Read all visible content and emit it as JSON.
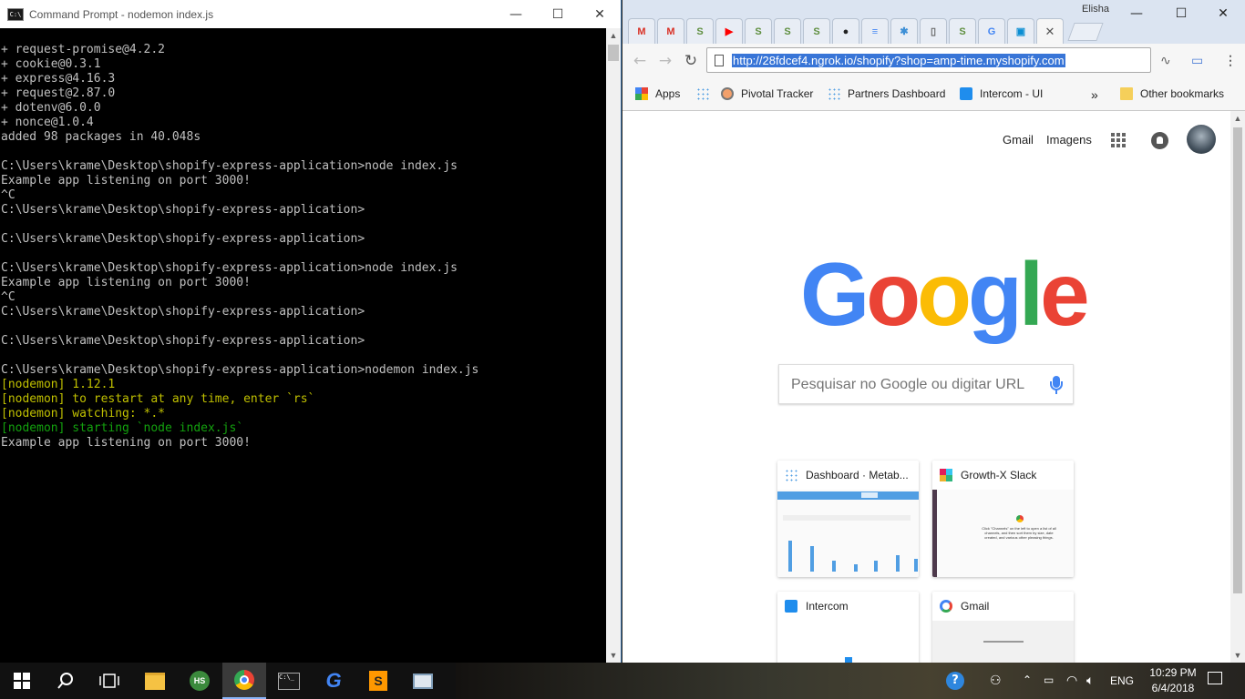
{
  "cmd": {
    "title": "Command Prompt - nodemon  index.js",
    "lines": [
      {
        "text": "+ request-promise@4.2.2",
        "color": ""
      },
      {
        "text": "+ cookie@0.3.1",
        "color": ""
      },
      {
        "text": "+ express@4.16.3",
        "color": ""
      },
      {
        "text": "+ request@2.87.0",
        "color": ""
      },
      {
        "text": "+ dotenv@6.0.0",
        "color": ""
      },
      {
        "text": "+ nonce@1.0.4",
        "color": ""
      },
      {
        "text": "added 98 packages in 40.048s",
        "color": ""
      },
      {
        "text": "",
        "color": ""
      },
      {
        "text": "C:\\Users\\krame\\Desktop\\shopify-express-application>node index.js",
        "color": ""
      },
      {
        "text": "Example app listening on port 3000!",
        "color": ""
      },
      {
        "text": "^C",
        "color": ""
      },
      {
        "text": "C:\\Users\\krame\\Desktop\\shopify-express-application>",
        "color": ""
      },
      {
        "text": "",
        "color": ""
      },
      {
        "text": "C:\\Users\\krame\\Desktop\\shopify-express-application>",
        "color": ""
      },
      {
        "text": "",
        "color": ""
      },
      {
        "text": "C:\\Users\\krame\\Desktop\\shopify-express-application>node index.js",
        "color": ""
      },
      {
        "text": "Example app listening on port 3000!",
        "color": ""
      },
      {
        "text": "^C",
        "color": ""
      },
      {
        "text": "C:\\Users\\krame\\Desktop\\shopify-express-application>",
        "color": ""
      },
      {
        "text": "",
        "color": ""
      },
      {
        "text": "C:\\Users\\krame\\Desktop\\shopify-express-application>",
        "color": ""
      },
      {
        "text": "",
        "color": ""
      },
      {
        "text": "C:\\Users\\krame\\Desktop\\shopify-express-application>nodemon index.js",
        "color": ""
      },
      {
        "text": "[nodemon] 1.12.1",
        "color": "yellow"
      },
      {
        "text": "[nodemon] to restart at any time, enter `rs`",
        "color": "yellow"
      },
      {
        "text": "[nodemon] watching: *.*",
        "color": "yellow"
      },
      {
        "text": "[nodemon] starting `node index.js`",
        "color": "green"
      },
      {
        "text": "Example app listening on port 3000!",
        "color": ""
      }
    ]
  },
  "chrome": {
    "profile_name": "Elisha",
    "tabs": [
      {
        "icon": "gmail-icon",
        "glyph": "M",
        "color": "#d93025"
      },
      {
        "icon": "gmail-icon",
        "glyph": "M",
        "color": "#d93025"
      },
      {
        "icon": "shopify-icon",
        "glyph": "S",
        "color": "#5e8e3e"
      },
      {
        "icon": "youtube-icon",
        "glyph": "▶",
        "color": "#ff0000"
      },
      {
        "icon": "shopify-icon",
        "glyph": "S",
        "color": "#5e8e3e"
      },
      {
        "icon": "shopify-icon",
        "glyph": "S",
        "color": "#5e8e3e"
      },
      {
        "icon": "shopify-icon",
        "glyph": "S",
        "color": "#5e8e3e"
      },
      {
        "icon": "github-icon",
        "glyph": "●",
        "color": "#222222"
      },
      {
        "icon": "google-docs-icon",
        "glyph": "≡",
        "color": "#4285f4"
      },
      {
        "icon": "puzzle-icon",
        "glyph": "✱",
        "color": "#3d8fd6"
      },
      {
        "icon": "file-icon",
        "glyph": "▯",
        "color": "#666666"
      },
      {
        "icon": "shopify-icon",
        "glyph": "S",
        "color": "#5e8e3e"
      },
      {
        "icon": "google-icon",
        "glyph": "G",
        "color": "#4285f4"
      },
      {
        "icon": "app-icon",
        "glyph": "▣",
        "color": "#0b8ed3"
      }
    ],
    "url": "http://28fdcef4.ngrok.io/shopify?shop=amp-time.myshopify.com",
    "bookmarks": [
      {
        "label": "Apps"
      },
      {
        "label": ""
      },
      {
        "label": "Pivotal Tracker"
      },
      {
        "label": "Partners Dashboard"
      },
      {
        "label": "Intercom - UI"
      }
    ],
    "bookmarks_more": "»",
    "other_bookmarks": "Other bookmarks",
    "ntp": {
      "gmail_link": "Gmail",
      "images_link": "Imagens",
      "logo_letters": [
        {
          "ch": "G",
          "color": "#4285f4"
        },
        {
          "ch": "o",
          "color": "#ea4335"
        },
        {
          "ch": "o",
          "color": "#fbbc05"
        },
        {
          "ch": "g",
          "color": "#4285f4"
        },
        {
          "ch": "l",
          "color": "#34a853"
        },
        {
          "ch": "e",
          "color": "#ea4335"
        }
      ],
      "search_placeholder": "Pesquisar no Google ou digitar URL",
      "tiles": [
        {
          "title": "Dashboard · Metab...",
          "icon": "metabase-icon"
        },
        {
          "title": "Growth-X Slack",
          "icon": "slack-icon"
        },
        {
          "title": "Intercom",
          "icon": "intercom-icon"
        },
        {
          "title": "Gmail",
          "icon": "google-icon"
        }
      ],
      "slack_thumb_text": "Click \"Channels\" on the left to open a list of all channels, and then sort them by size, date created, and various other pleasing things."
    }
  },
  "taskbar": {
    "time": "10:29 PM",
    "date": "6/4/2018",
    "language": "ENG"
  }
}
